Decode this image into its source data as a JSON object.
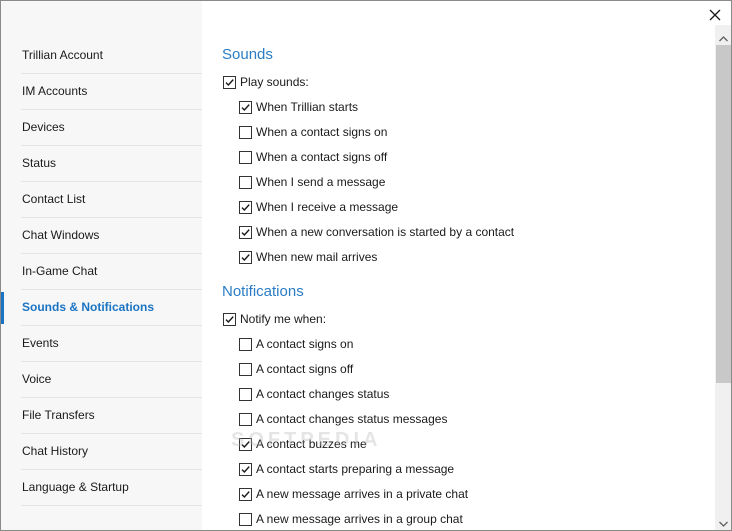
{
  "sidebar": {
    "items": [
      {
        "label": "Trillian Account"
      },
      {
        "label": "IM Accounts"
      },
      {
        "label": "Devices"
      },
      {
        "label": "Status"
      },
      {
        "label": "Contact List"
      },
      {
        "label": "Chat Windows"
      },
      {
        "label": "In-Game Chat"
      },
      {
        "label": "Sounds & Notifications",
        "active": true
      },
      {
        "label": "Events"
      },
      {
        "label": "Voice"
      },
      {
        "label": "File Transfers"
      },
      {
        "label": "Chat History"
      },
      {
        "label": "Language & Startup"
      }
    ]
  },
  "sounds": {
    "title": "Sounds",
    "master": {
      "label": "Play sounds:",
      "checked": true
    },
    "options": [
      {
        "label": "When Trillian starts",
        "checked": true
      },
      {
        "label": "When a contact signs on",
        "checked": false
      },
      {
        "label": "When a contact signs off",
        "checked": false
      },
      {
        "label": "When I send a message",
        "checked": false
      },
      {
        "label": "When I receive a message",
        "checked": true
      },
      {
        "label": "When a new conversation is started by a contact",
        "checked": true
      },
      {
        "label": "When new mail arrives",
        "checked": true
      }
    ]
  },
  "notifications": {
    "title": "Notifications",
    "master": {
      "label": "Notify me when:",
      "checked": true
    },
    "options": [
      {
        "label": "A contact signs on",
        "checked": false
      },
      {
        "label": "A contact signs off",
        "checked": false
      },
      {
        "label": "A contact changes status",
        "checked": false
      },
      {
        "label": "A contact changes status messages",
        "checked": false
      },
      {
        "label": "A contact buzzes me",
        "checked": true
      },
      {
        "label": "A contact starts preparing a message",
        "checked": true
      },
      {
        "label": "A new message arrives in a private chat",
        "checked": true
      },
      {
        "label": "A new message arrives in a group chat",
        "checked": false
      }
    ]
  },
  "watermark": "SOFTPEDIA",
  "colors": {
    "accent": "#1a74c4",
    "sidebar_bg": "#f7f7f7",
    "section_title": "#2a7cc5"
  },
  "icons": {
    "close": "close-icon",
    "check": "checkmark-icon",
    "scroll_up": "chevron-up-icon",
    "scroll_down": "chevron-down-icon"
  }
}
